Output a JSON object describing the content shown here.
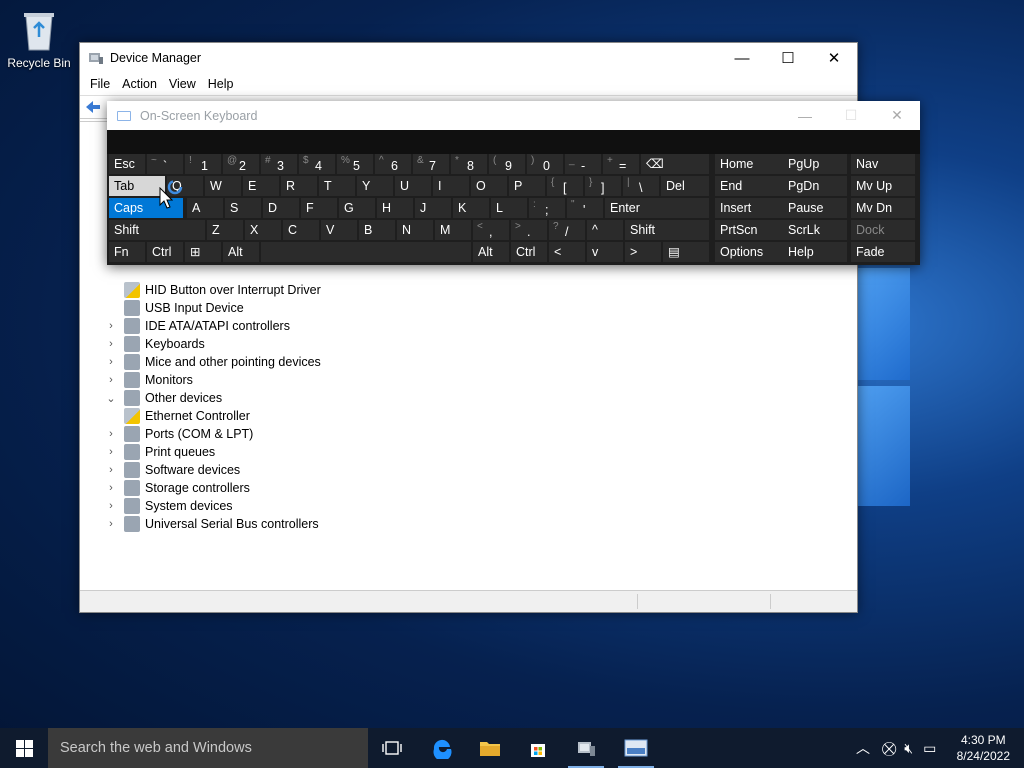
{
  "desktop": {
    "recycle_bin_label": "Recycle Bin"
  },
  "device_manager": {
    "title": "Device Manager",
    "menu": [
      "File",
      "Action",
      "View",
      "Help"
    ],
    "tree": [
      {
        "label": "HID Button over Interrupt Driver",
        "icon": "warning-device-icon",
        "indent": 2,
        "chevron": ""
      },
      {
        "label": "USB Input Device",
        "icon": "hid-device-icon",
        "indent": 2,
        "chevron": ""
      },
      {
        "label": "IDE ATA/ATAPI controllers",
        "icon": "ide-controller-icon",
        "indent": 1,
        "chevron": ">"
      },
      {
        "label": "Keyboards",
        "icon": "keyboard-icon",
        "indent": 1,
        "chevron": ">"
      },
      {
        "label": "Mice and other pointing devices",
        "icon": "mouse-icon",
        "indent": 1,
        "chevron": ">"
      },
      {
        "label": "Monitors",
        "icon": "monitor-icon",
        "indent": 1,
        "chevron": ">"
      },
      {
        "label": "Other devices",
        "icon": "other-devices-icon",
        "indent": 1,
        "chevron": "v"
      },
      {
        "label": "Ethernet Controller",
        "icon": "warning-device-icon",
        "indent": 2,
        "chevron": ""
      },
      {
        "label": "Ports (COM & LPT)",
        "icon": "ports-icon",
        "indent": 1,
        "chevron": ">"
      },
      {
        "label": "Print queues",
        "icon": "printer-icon",
        "indent": 1,
        "chevron": ">"
      },
      {
        "label": "Software devices",
        "icon": "software-device-icon",
        "indent": 1,
        "chevron": ">"
      },
      {
        "label": "Storage controllers",
        "icon": "storage-icon",
        "indent": 1,
        "chevron": ">"
      },
      {
        "label": "System devices",
        "icon": "system-devices-icon",
        "indent": 1,
        "chevron": ">"
      },
      {
        "label": "Universal Serial Bus controllers",
        "icon": "usb-icon",
        "indent": 1,
        "chevron": ">"
      }
    ]
  },
  "osk": {
    "title": "On-Screen Keyboard",
    "rows": [
      [
        {
          "m": "Esc"
        },
        {
          "s": "~",
          "m": "`"
        },
        {
          "s": "!",
          "m": "1"
        },
        {
          "s": "@",
          "m": "2"
        },
        {
          "s": "#",
          "m": "3"
        },
        {
          "s": "$",
          "m": "4"
        },
        {
          "s": "%",
          "m": "5"
        },
        {
          "s": "^",
          "m": "6"
        },
        {
          "s": "&",
          "m": "7"
        },
        {
          "s": "*",
          "m": "8"
        },
        {
          "s": "(",
          "m": "9"
        },
        {
          "s": ")",
          "m": "0"
        },
        {
          "s": "_",
          "m": "-"
        },
        {
          "s": "+",
          "m": "="
        },
        {
          "m": "⌫"
        },
        {
          "m": "Home"
        },
        {
          "m": "PgUp"
        },
        {
          "m": "Nav"
        }
      ],
      [
        {
          "m": "Tab",
          "state": "hot"
        },
        {
          "m": "Q"
        },
        {
          "m": "W"
        },
        {
          "m": "E"
        },
        {
          "m": "R"
        },
        {
          "m": "T"
        },
        {
          "m": "Y"
        },
        {
          "m": "U"
        },
        {
          "m": "I"
        },
        {
          "m": "O"
        },
        {
          "m": "P"
        },
        {
          "s": "{",
          "m": "["
        },
        {
          "s": "}",
          "m": "]"
        },
        {
          "s": "|",
          "m": "\\"
        },
        {
          "m": "Del"
        },
        {
          "m": "End"
        },
        {
          "m": "PgDn"
        },
        {
          "m": "Mv Up"
        }
      ],
      [
        {
          "m": "Caps",
          "state": "sel"
        },
        {
          "m": "A"
        },
        {
          "m": "S"
        },
        {
          "m": "D"
        },
        {
          "m": "F"
        },
        {
          "m": "G"
        },
        {
          "m": "H"
        },
        {
          "m": "J"
        },
        {
          "m": "K"
        },
        {
          "m": "L"
        },
        {
          "s": ":",
          "m": ";"
        },
        {
          "s": "\"",
          "m": "'"
        },
        {
          "m": "Enter"
        },
        {
          "m": "Insert"
        },
        {
          "m": "Pause"
        },
        {
          "m": "Mv Dn"
        }
      ],
      [
        {
          "m": "Shift"
        },
        {
          "m": "Z"
        },
        {
          "m": "X"
        },
        {
          "m": "C"
        },
        {
          "m": "V"
        },
        {
          "m": "B"
        },
        {
          "m": "N"
        },
        {
          "m": "M"
        },
        {
          "s": "<",
          "m": ","
        },
        {
          "s": ">",
          "m": "."
        },
        {
          "s": "?",
          "m": "/"
        },
        {
          "m": "^"
        },
        {
          "m": "Shift"
        },
        {
          "m": "PrtScn"
        },
        {
          "m": "ScrLk"
        },
        {
          "m": "Dock",
          "state": "dim"
        }
      ],
      [
        {
          "m": "Fn"
        },
        {
          "m": "Ctrl"
        },
        {
          "m": "⊞"
        },
        {
          "m": "Alt"
        },
        {
          "m": ""
        },
        {
          "m": "Alt"
        },
        {
          "m": "Ctrl"
        },
        {
          "m": "<"
        },
        {
          "m": "v"
        },
        {
          "m": ">"
        },
        {
          "m": "▤"
        },
        {
          "m": "Options"
        },
        {
          "m": "Help"
        },
        {
          "m": "Fade"
        }
      ]
    ]
  },
  "taskbar": {
    "search_placeholder": "Search the web and Windows",
    "time": "4:30 PM",
    "date": "8/24/2022"
  }
}
